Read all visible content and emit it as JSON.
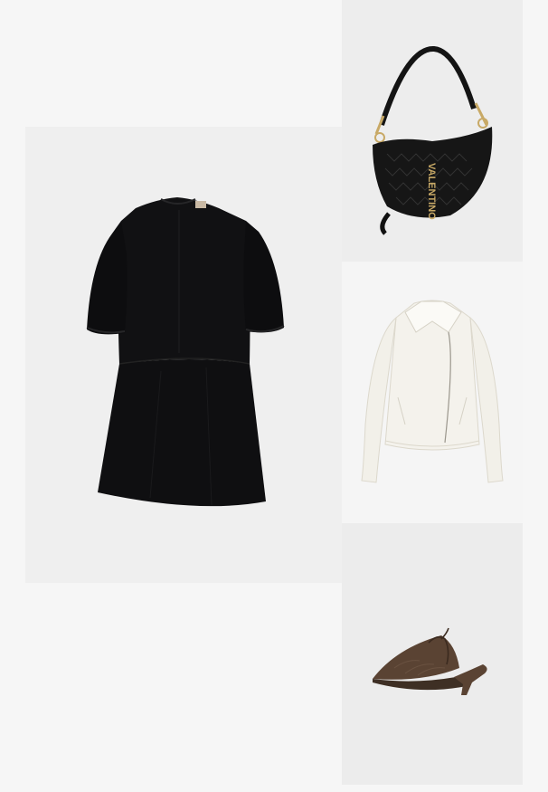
{
  "outfit": {
    "items": [
      {
        "id": "dress",
        "type": "dress",
        "color": "#0f0f11"
      },
      {
        "id": "bag",
        "type": "handbag",
        "brand_print": "VALENTINO",
        "color": "#161616",
        "hardware_color": "#c8a966"
      },
      {
        "id": "jacket",
        "type": "jacket",
        "color": "#f4f2ec"
      },
      {
        "id": "shoe",
        "type": "mule",
        "color": "#5a4333"
      }
    ]
  }
}
